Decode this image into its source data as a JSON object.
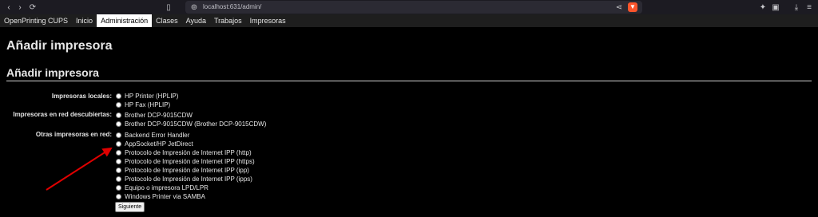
{
  "browser": {
    "url": "localhost:631/admin/"
  },
  "nav": {
    "items": [
      "OpenPrinting CUPS",
      "Inicio",
      "Administración",
      "Clases",
      "Ayuda",
      "Trabajos",
      "Impresoras"
    ]
  },
  "page": {
    "title": "Añadir impresora",
    "section_title": "Añadir impresora"
  },
  "groups": {
    "local_label": "Impresoras locales:",
    "local": [
      "HP Printer (HPLIP)",
      "HP Fax (HPLIP)"
    ],
    "discovered_label": "Impresoras en red descubiertas:",
    "discovered": [
      "Brother DCP-9015CDW",
      "Brother DCP-9015CDW (Brother DCP-9015CDW)"
    ],
    "other_label": "Otras impresoras en red:",
    "other": [
      "Backend Error Handler",
      "AppSocket/HP JetDirect",
      "Protocolo de Impresión de Internet IPP (http)",
      "Protocolo de Impresión de Internet IPP (https)",
      "Protocolo de Impresión de Internet IPP (ipp)",
      "Protocolo de Impresión de Internet IPP (ipps)",
      "Equipo o impresora LPD/LPR",
      "Windows Printer via SAMBA"
    ]
  },
  "button": {
    "next": "Siguiente"
  },
  "colors": {
    "annotation_arrow": "#e00000",
    "browser_badge": "#fb542b"
  }
}
